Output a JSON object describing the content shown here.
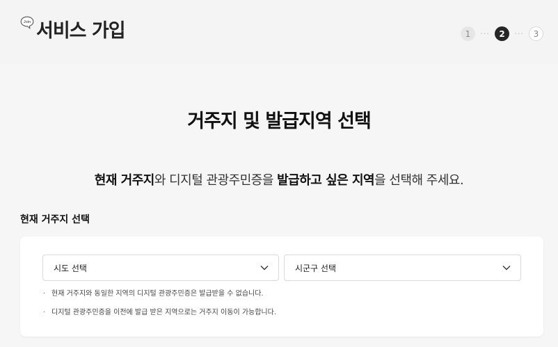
{
  "header": {
    "icon_text": "Join",
    "title": "서비스 가입",
    "steps": [
      {
        "label": "1",
        "state": "done"
      },
      {
        "label": "2",
        "state": "active"
      },
      {
        "label": "3",
        "state": "todo"
      }
    ],
    "step_separator": "···"
  },
  "main": {
    "heading": "거주지 및 발급지역 선택",
    "lead": {
      "part1_bold": "현재 거주지",
      "part2": "와 디지털 관광주민증을 ",
      "part3_bold": "발급하고 싶은 지역",
      "part4": "을 선택해 주세요."
    },
    "section_title": "현재 거주지 선택",
    "sido_select": {
      "value": "시도 선택",
      "icon": "chevron-down-icon"
    },
    "sigungu_select": {
      "value": "시군구 선택",
      "icon": "chevron-down-icon"
    },
    "notes": [
      "현재 거주지와 동일한 지역의 디지털 관광주민증은 발급받을 수 없습니다.",
      "디지털 관광주민증을 이전에 발급 받은 지역으로는 거주지 이동이 가능합니다."
    ],
    "bullet": "·"
  },
  "colors": {
    "background": "#f6f6f6",
    "header_bg": "#f4f4f5",
    "step_active": "#262626",
    "card_bg": "#ffffff"
  }
}
